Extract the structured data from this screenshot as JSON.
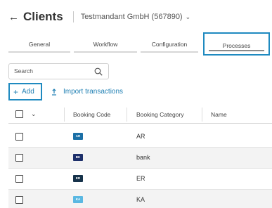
{
  "header": {
    "back_glyph": "←",
    "title": "Clients",
    "tenant": "Testmandant GmbH (567890)",
    "tenant_chevron": "⌄"
  },
  "tabs": [
    {
      "label": "General",
      "active": false
    },
    {
      "label": "Workflow",
      "active": false
    },
    {
      "label": "Configuration",
      "active": false
    },
    {
      "label": "Processes",
      "active": true
    }
  ],
  "search": {
    "placeholder": "Search",
    "icon": "search-icon"
  },
  "toolbar": {
    "add_glyph": "+",
    "add_label": "Add",
    "import_label": "Import transactions",
    "import_icon": "upload-icon"
  },
  "table": {
    "chevron": "⌄",
    "columns": [
      "Booking Code",
      "Booking Category",
      "Name"
    ],
    "rows": [
      {
        "code": "AR",
        "category": "AR",
        "badge_color": "#1b6fa6"
      },
      {
        "code": "BK",
        "category": "bank",
        "badge_color": "#1c2f6a"
      },
      {
        "code": "ER",
        "category": "ER",
        "badge_color": "#16324a"
      },
      {
        "code": "KA",
        "category": "KA",
        "badge_color": "#5ab8e2"
      }
    ]
  },
  "colors": {
    "accent": "#1f7fb3",
    "highlight_border": "#1f8ac0"
  }
}
